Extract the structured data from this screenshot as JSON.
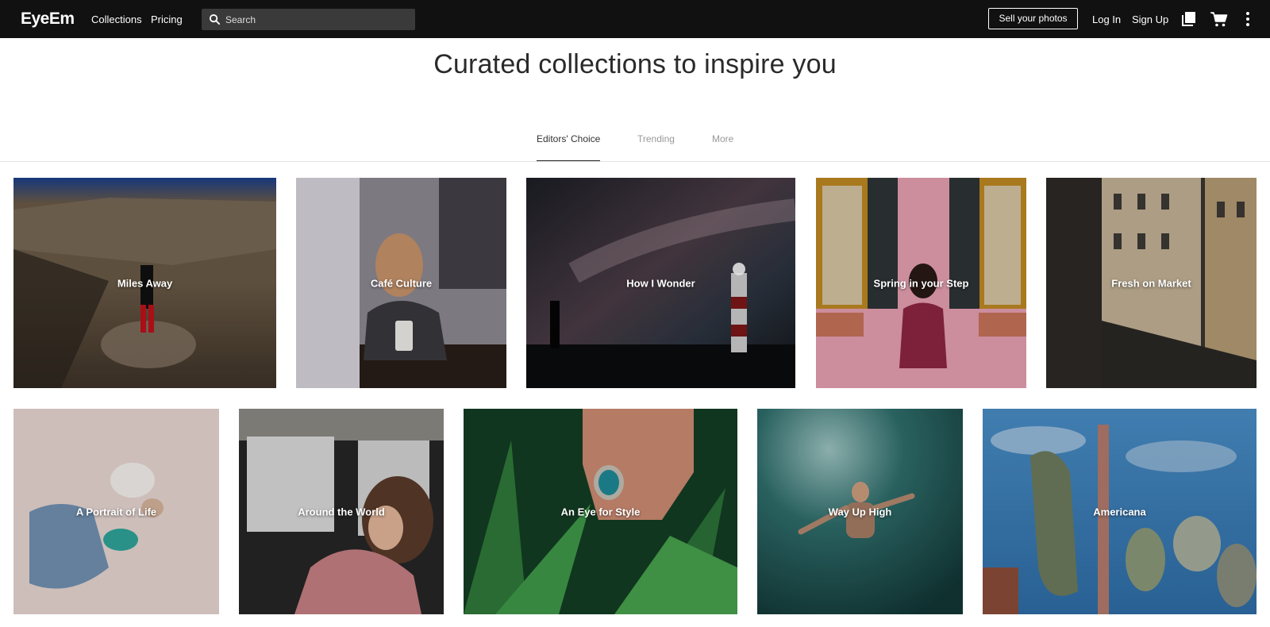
{
  "header": {
    "logo": "EyeEm",
    "nav": [
      "Collections",
      "Pricing"
    ],
    "search_placeholder": "Search",
    "sell_label": "Sell your photos",
    "login_label": "Log In",
    "signup_label": "Sign Up",
    "icons": [
      "collections-icon",
      "cart-icon",
      "more-vertical-icon"
    ]
  },
  "page": {
    "title": "Curated collections to inspire you"
  },
  "tabs": [
    {
      "label": "Editors' Choice",
      "active": true
    },
    {
      "label": "Trending",
      "active": false
    },
    {
      "label": "More",
      "active": false
    }
  ],
  "collections": [
    {
      "title": "Miles Away"
    },
    {
      "title": "Café Culture"
    },
    {
      "title": "How I Wonder"
    },
    {
      "title": "Spring in your Step"
    },
    {
      "title": "Fresh on Market"
    },
    {
      "title": "A Portrait of Life"
    },
    {
      "title": "Around the World"
    },
    {
      "title": "An Eye for Style"
    },
    {
      "title": "Way Up High"
    },
    {
      "title": "Americana"
    }
  ],
  "colors": {
    "topbar": "#111111",
    "accent_text": "#222222"
  }
}
